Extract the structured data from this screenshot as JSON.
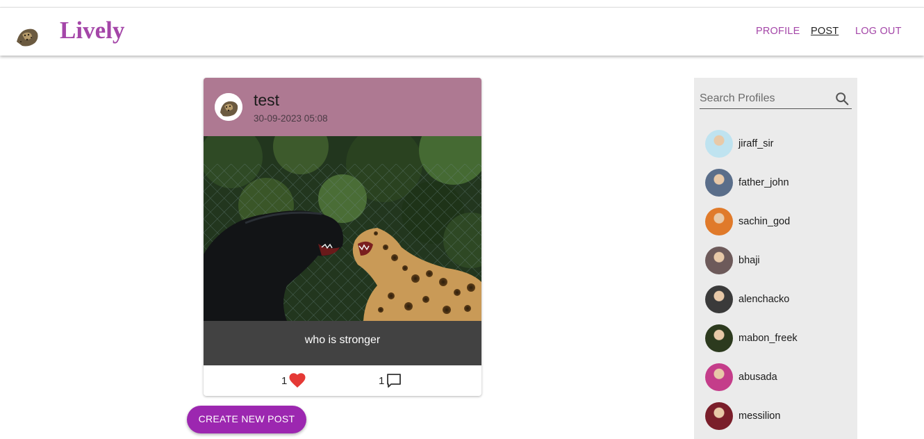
{
  "app": {
    "title": "Lively"
  },
  "nav": [
    {
      "label": "PROFILE",
      "active": false
    },
    {
      "label": "POST",
      "active": true
    },
    {
      "label": "LOG OUT",
      "active": false
    }
  ],
  "post": {
    "title": "test",
    "date": "30-09-2023 05:08",
    "caption": "who is stronger",
    "likes": "1",
    "comments": "1"
  },
  "create_button": "CREATE NEW POST",
  "search": {
    "placeholder": "Search Profiles"
  },
  "profiles": [
    {
      "name": "jiraff_sir",
      "color": "#bfe3f0"
    },
    {
      "name": "father_john",
      "color": "#5a6e8a"
    },
    {
      "name": "sachin_god",
      "color": "#e07a2a"
    },
    {
      "name": "bhaji",
      "color": "#6d5a5a"
    },
    {
      "name": "alenchacko",
      "color": "#3a3a3a"
    },
    {
      "name": "mabon_freek",
      "color": "#2c3a1e"
    },
    {
      "name": "abusada",
      "color": "#c43d8a"
    },
    {
      "name": "messilion",
      "color": "#7a1e2a"
    }
  ],
  "colors": {
    "accent": "#a446a8",
    "card_header": "#ae7992",
    "button": "#9c27b0",
    "caption_bg": "#424242",
    "like_heart": "#e53935"
  }
}
